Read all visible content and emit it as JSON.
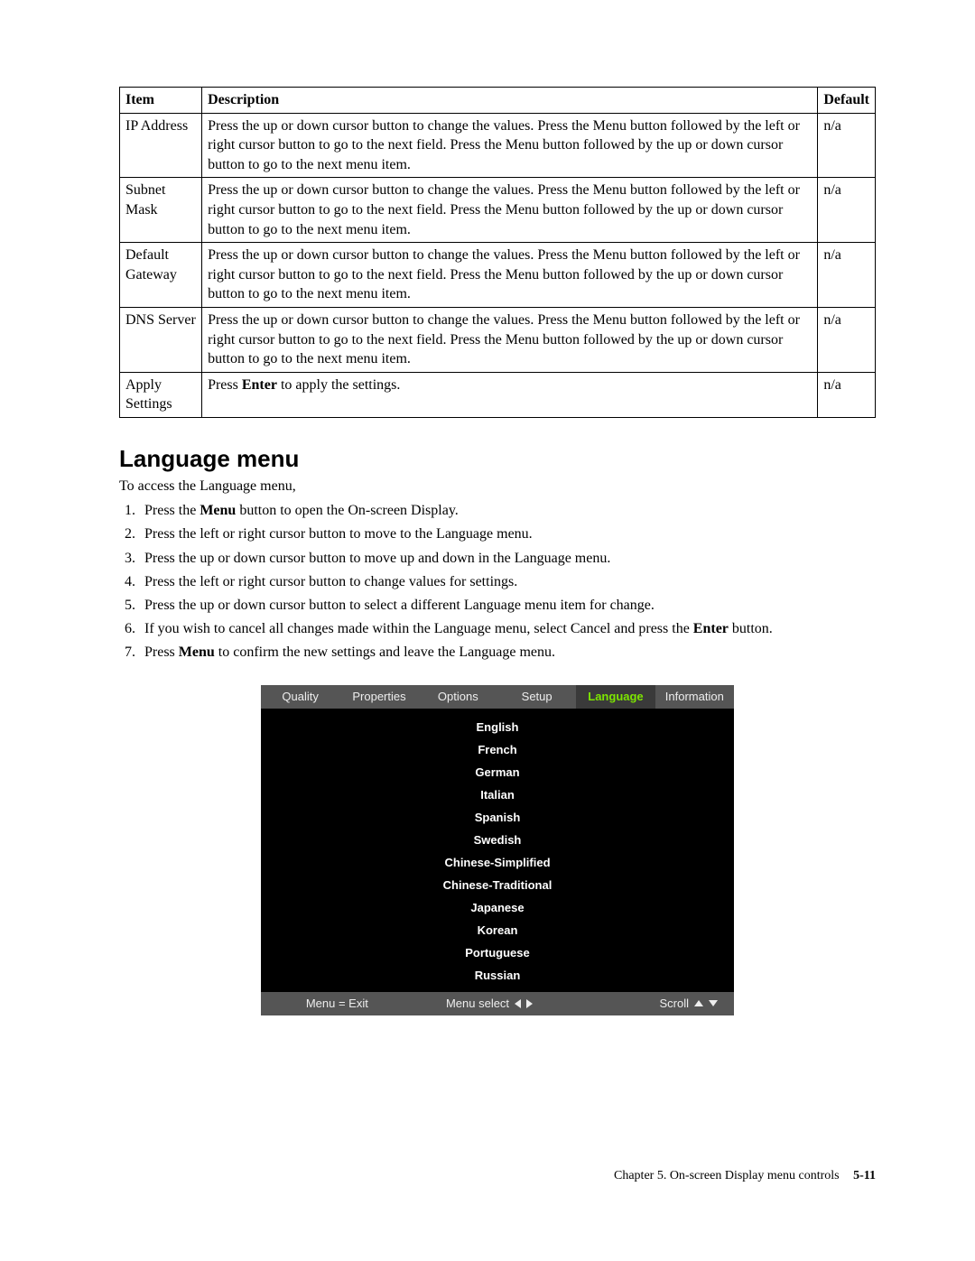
{
  "table": {
    "headers": [
      "Item",
      "Description",
      "Default"
    ],
    "rows": [
      {
        "item": "IP Address",
        "desc": "Press the up or down cursor button to change the values. Press the Menu button followed by the left or right cursor button to go to the next field. Press the Menu button followed by the up or down cursor button to go to the next menu item.",
        "def": "n/a"
      },
      {
        "item": "Subnet Mask",
        "desc": "Press the up or down cursor button to change the values. Press the Menu button followed by the left or right cursor button to go to the next field. Press the Menu button followed by the up or down cursor button to go to the next menu item.",
        "def": "n/a"
      },
      {
        "item": "Default Gateway",
        "desc": "Press the up or down cursor button to change the values. Press the Menu button followed by the left or right cursor button to go to the next field. Press the Menu button followed by the up or down cursor button to go to the next menu item.",
        "def": "n/a"
      },
      {
        "item": "DNS Server",
        "desc": "Press the up or down cursor button to change the values. Press the Menu button followed by the left or right cursor button to go to the next field. Press the Menu button followed by the up or down cursor button to go to the next menu item.",
        "def": "n/a"
      },
      {
        "item": "Apply Settings",
        "desc_pre": "Press ",
        "desc_bold": "Enter",
        "desc_post": " to apply the settings.",
        "def": "n/a"
      }
    ]
  },
  "section_heading": "Language menu",
  "intro": "To access the Language menu,",
  "steps": [
    {
      "pre": "Press the ",
      "bold": "Menu",
      "post": " button to open the On-screen Display."
    },
    {
      "text": "Press the left or right cursor button to move to the Language menu."
    },
    {
      "text": "Press the up or down cursor button to move up and down in the Language menu."
    },
    {
      "text": "Press the left or right cursor button to change values for settings."
    },
    {
      "text": "Press the up or down cursor button to select a different Language menu item for change."
    },
    {
      "pre": "If you wish to cancel all changes made within the Language menu, select Cancel and press the ",
      "bold": "Enter",
      "post": " button."
    },
    {
      "pre": "Press ",
      "bold": "Menu",
      "post": " to confirm the new settings and leave the Language menu."
    }
  ],
  "osd": {
    "tabs": [
      "Quality",
      "Properties",
      "Options",
      "Setup",
      "Language",
      "Information"
    ],
    "active_tab": "Language",
    "items": [
      "English",
      "French",
      "German",
      "Italian",
      "Spanish",
      "Swedish",
      "Chinese-Simplified",
      "Chinese-Traditional",
      "Japanese",
      "Korean",
      "Portuguese",
      "Russian"
    ],
    "footer": {
      "left": "Menu = Exit",
      "middle": "Menu select",
      "right": "Scroll"
    }
  },
  "footer": {
    "chapter": "Chapter 5. On-screen Display menu controls",
    "page": "5-11"
  }
}
